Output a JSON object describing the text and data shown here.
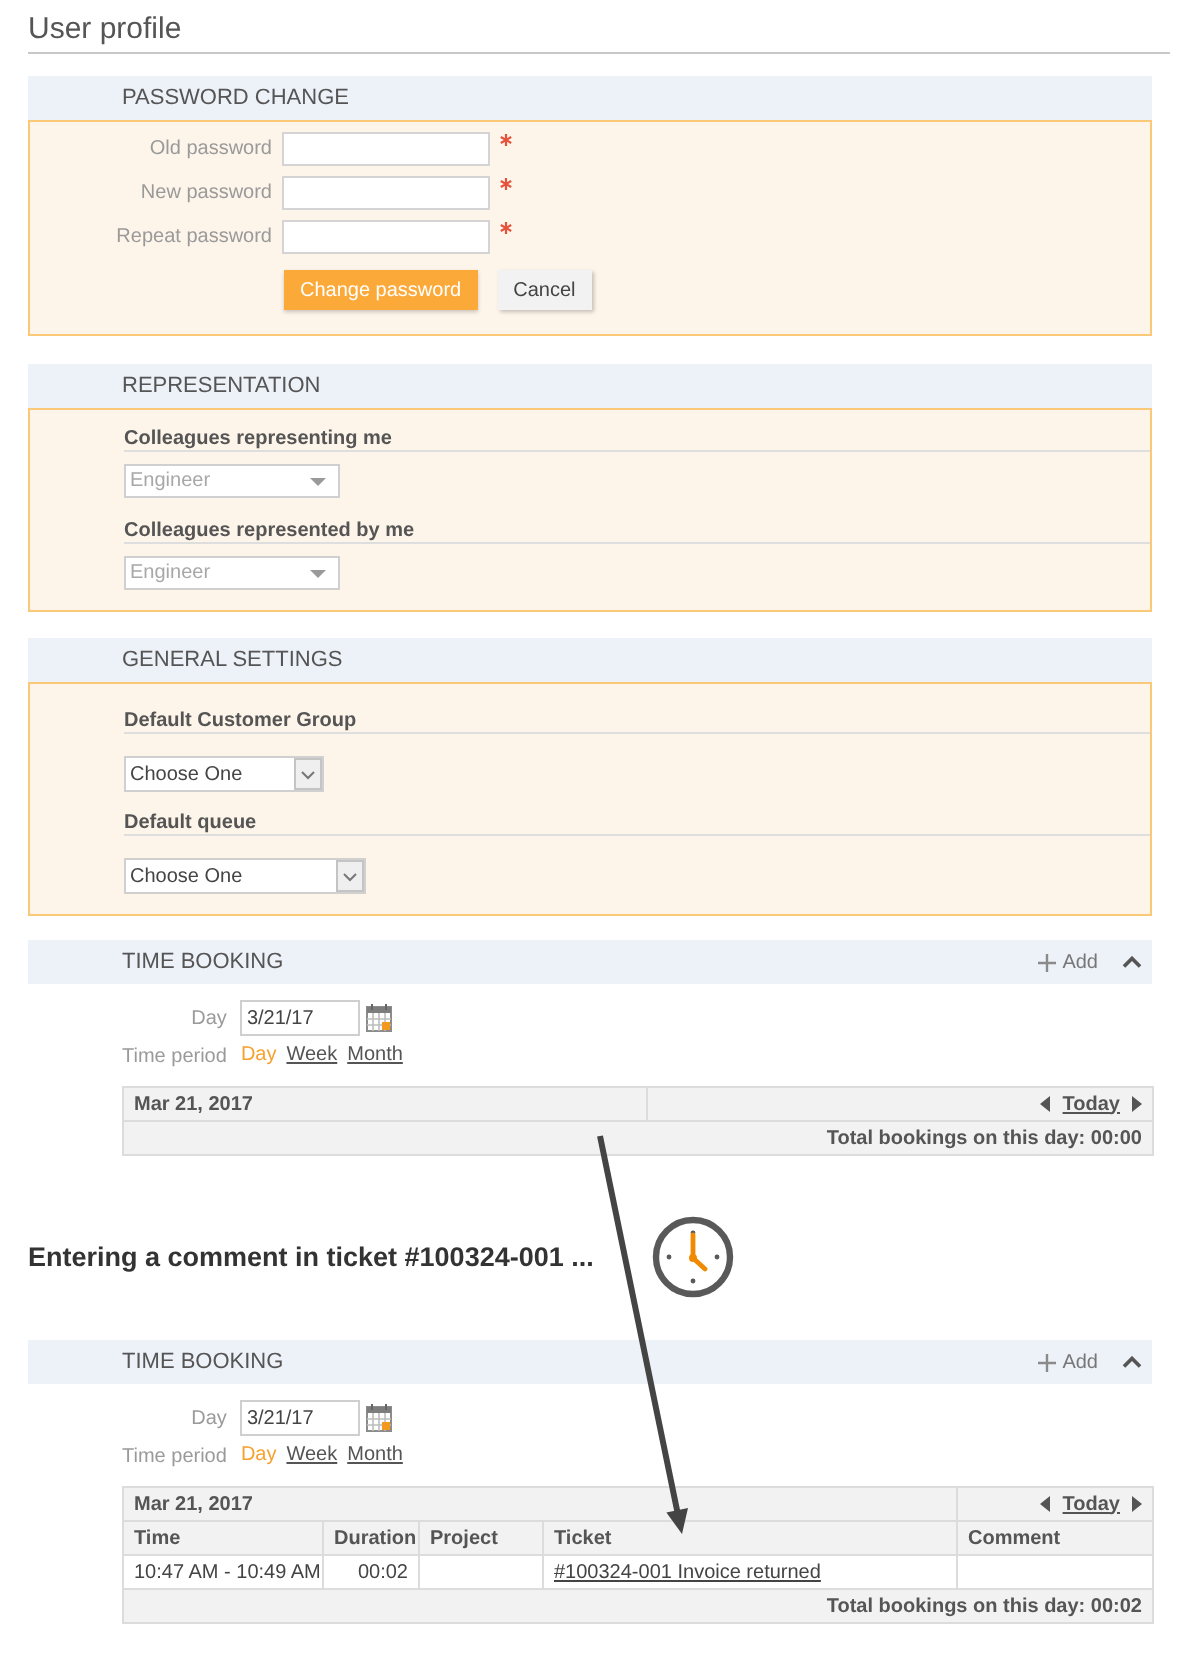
{
  "page_title": "User profile",
  "password_change": {
    "title": "PASSWORD CHANGE",
    "fields": [
      {
        "label": "Old password",
        "required": true
      },
      {
        "label": "New password",
        "required": true
      },
      {
        "label": "Repeat password",
        "required": true
      }
    ],
    "buttons": [
      {
        "label": "Change password",
        "kind": "primary"
      },
      {
        "label": "Cancel",
        "kind": "secondary"
      }
    ]
  },
  "representation": {
    "title": "REPRESENTATION",
    "groups": [
      {
        "label": "Colleagues representing me",
        "select": {
          "value": "Engineer",
          "disabled": true
        }
      },
      {
        "label": "Colleagues represented by me",
        "select": {
          "value": "Engineer",
          "disabled": true
        }
      }
    ]
  },
  "general_settings": {
    "title": "GENERAL SETTINGS",
    "groups": [
      {
        "label": "Default Customer Group",
        "select": {
          "value": "Choose One",
          "disabled": false
        }
      },
      {
        "label": "Default queue",
        "select": {
          "value": "Choose One",
          "disabled": false
        }
      }
    ]
  },
  "time_booking_before": {
    "title": "TIME BOOKING",
    "add_label": "Add",
    "expanded": true,
    "day": {
      "label": "Day",
      "value": "3/21/17"
    },
    "period": {
      "label": "Time period",
      "options": [
        {
          "label": "Day",
          "selected": true
        },
        {
          "label": "Week",
          "selected": false
        },
        {
          "label": "Month",
          "selected": false
        }
      ]
    },
    "table": {
      "date": "Mar 21, 2017",
      "nav_label": "Today",
      "total": "Total bookings on this day: 00:00"
    }
  },
  "annotation": "Entering a comment in ticket #100324-001 ...",
  "time_booking_after": {
    "title": "TIME BOOKING",
    "add_label": "Add",
    "expanded": true,
    "day": {
      "label": "Day",
      "value": "3/21/17"
    },
    "period": {
      "label": "Time period",
      "options": [
        {
          "label": "Day",
          "selected": true
        },
        {
          "label": "Week",
          "selected": false
        },
        {
          "label": "Month",
          "selected": false
        }
      ]
    },
    "table": {
      "date": "Mar 21, 2017",
      "nav_label": "Today",
      "columns": [
        {
          "label": "Time",
          "kind": "text"
        },
        {
          "label": "Duration",
          "kind": "number"
        },
        {
          "label": "Project",
          "kind": "text"
        },
        {
          "label": "Ticket",
          "kind": "link"
        },
        {
          "label": "Comment",
          "kind": "text"
        }
      ],
      "rows": [
        {
          "cells": [
            "10:47 AM - 10:49 AM",
            "00:02",
            null,
            "#100324-001 Invoice returned",
            null
          ]
        }
      ],
      "total": "Total bookings on this day: 00:02"
    }
  }
}
